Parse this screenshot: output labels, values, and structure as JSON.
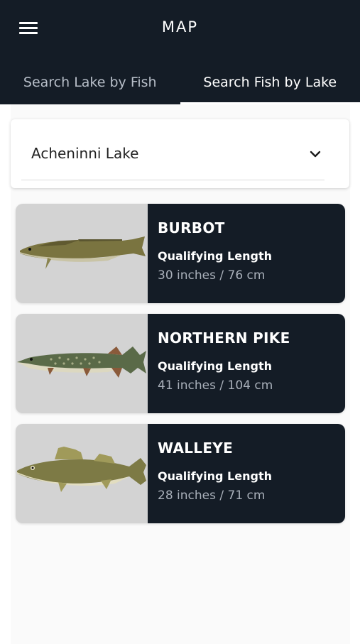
{
  "header": {
    "title": "MAP",
    "menu_icon": "hamburger-menu-icon"
  },
  "tabs": [
    {
      "label": "Search Lake by Fish",
      "active": false
    },
    {
      "label": "Search Fish by Lake",
      "active": true
    }
  ],
  "lake_select": {
    "value": "Acheninni Lake",
    "icon": "chevron-down-icon"
  },
  "fish": [
    {
      "name": "BURBOT",
      "length_label": "Qualifying Length",
      "length_value": "30 inches / 76 cm",
      "image": "burbot-image"
    },
    {
      "name": "NORTHERN PIKE",
      "length_label": "Qualifying Length",
      "length_value": "41 inches / 104 cm",
      "image": "northern-pike-image"
    },
    {
      "name": "WALLEYE",
      "length_label": "Qualifying Length",
      "length_value": "28 inches / 71 cm",
      "image": "walleye-image"
    }
  ],
  "colors": {
    "header_bg": "#141c26",
    "card_info_bg": "#141c26",
    "image_bg": "#d3d3d3",
    "muted_text": "#a9b0ba"
  }
}
